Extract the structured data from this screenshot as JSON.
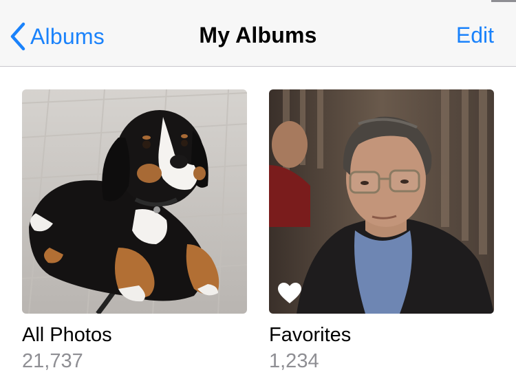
{
  "navbar": {
    "back_label": "Albums",
    "title": "My Albums",
    "edit_label": "Edit"
  },
  "albums": [
    {
      "title": "All Photos",
      "count": "21,737",
      "thumbnail": "puppy-photo"
    },
    {
      "title": "Favorites",
      "count": "1,234",
      "thumbnail": "man-portrait-photo",
      "badge_icon": "heart-icon"
    }
  ],
  "colors": {
    "accent": "#1a82fb",
    "secondary_text": "#8e8e93",
    "navbar_bg": "#f7f7f7"
  }
}
